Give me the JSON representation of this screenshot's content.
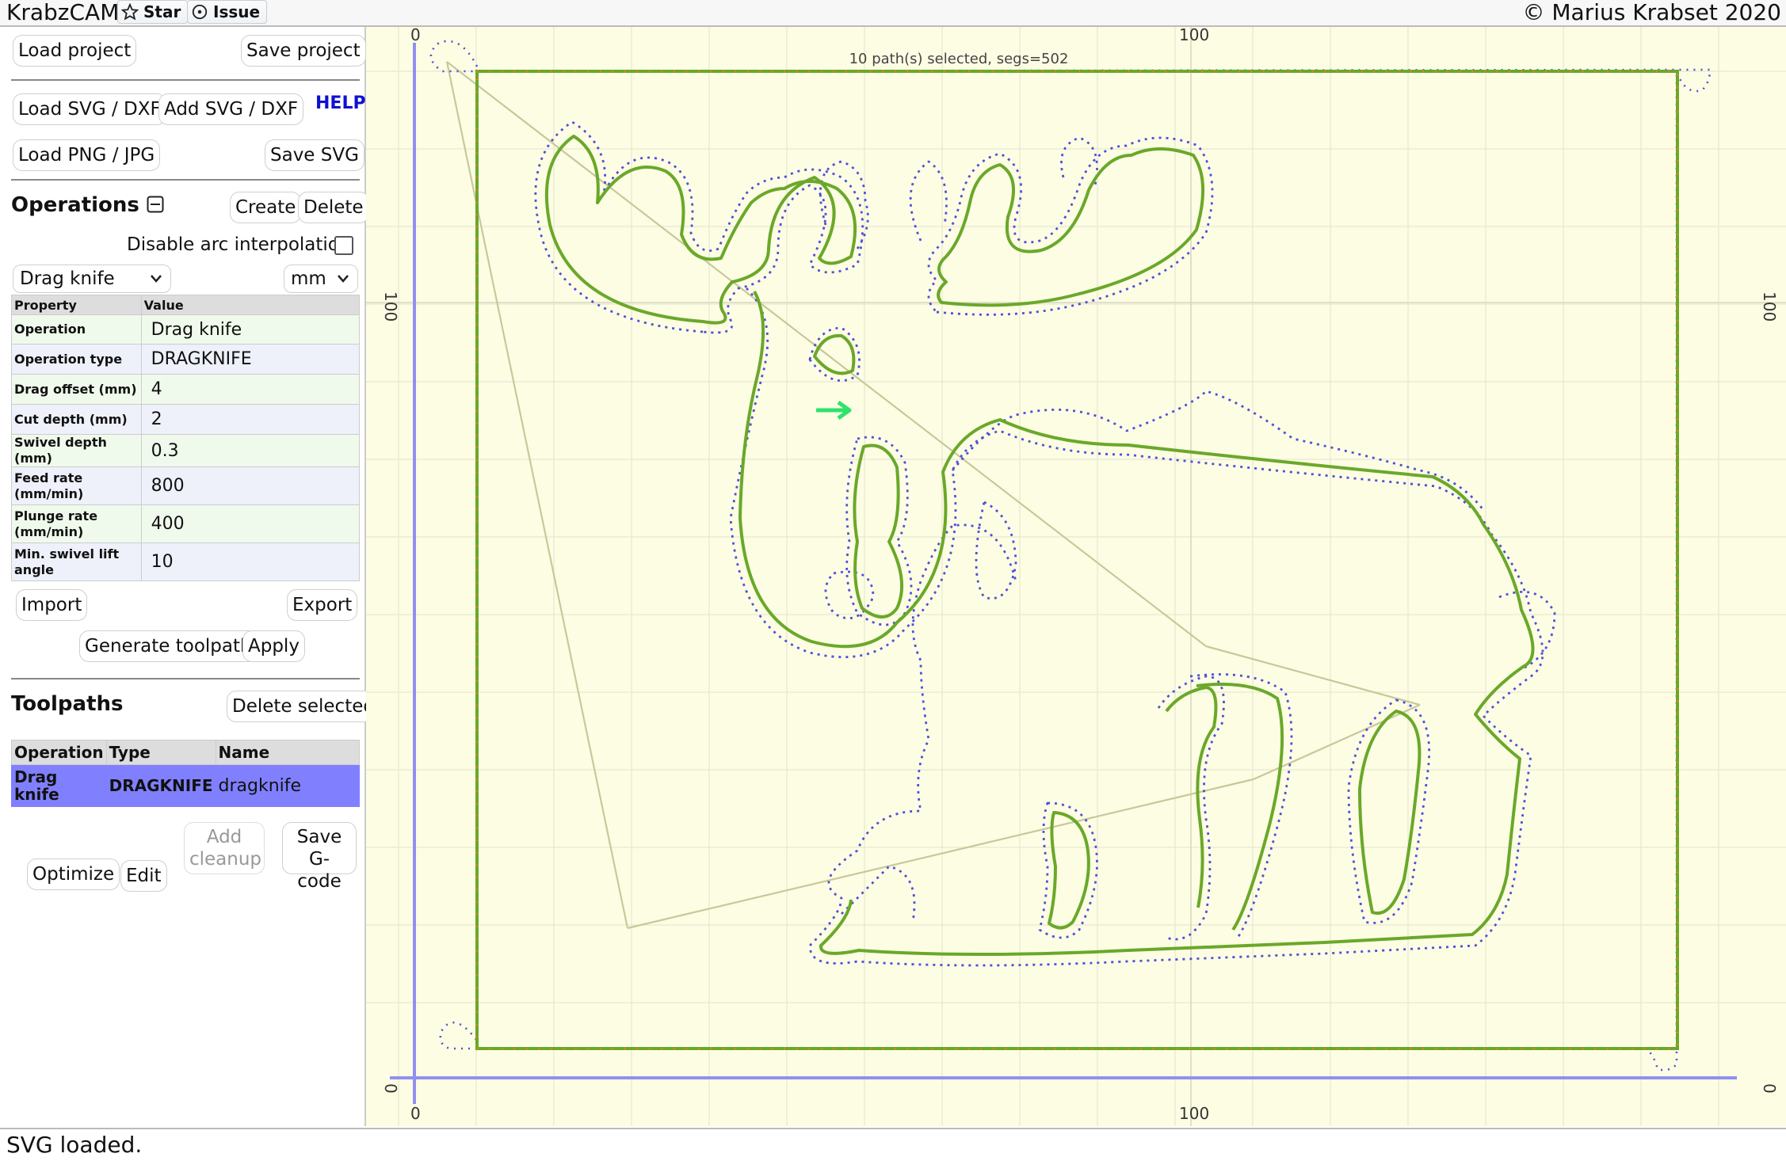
{
  "header": {
    "app_title": "KrabzCAM",
    "star_label": "Star",
    "issue_label": "Issue",
    "copyright": "© Marius Krabset 2020"
  },
  "left_panel": {
    "load_project": "Load project",
    "save_project": "Save project",
    "load_svg_dxf": "Load SVG / DXF",
    "add_svg_dxf": "Add SVG / DXF",
    "help": "HELP",
    "load_png_jpg": "Load PNG / JPG",
    "save_svg": "Save SVG",
    "operations": {
      "title": "Operations",
      "create": "Create",
      "delete": "Delete",
      "disable_arc_label": "Disable arc interpolation",
      "disable_arc_checked": false,
      "operation_select": "Drag knife",
      "unit_select": "mm",
      "table_headers": [
        "Property",
        "Value"
      ],
      "properties": [
        {
          "key": "Operation",
          "value": "Drag knife"
        },
        {
          "key": "Operation type",
          "value": "DRAGKNIFE"
        },
        {
          "key": "Drag offset (mm)",
          "value": "4"
        },
        {
          "key": "Cut depth (mm)",
          "value": "2"
        },
        {
          "key": "Swivel depth (mm)",
          "value": "0.3"
        },
        {
          "key": "Feed rate (mm/min)",
          "value": "800"
        },
        {
          "key": "Plunge rate (mm/min)",
          "value": "400"
        },
        {
          "key": "Min. swivel lift angle",
          "value": "10"
        }
      ],
      "import": "Import",
      "export": "Export",
      "generate_toolpath": "Generate toolpath",
      "apply": "Apply"
    },
    "toolpaths": {
      "title": "Toolpaths",
      "delete_selected": "Delete selected",
      "headers": [
        "Operation",
        "Type",
        "Name"
      ],
      "rows": [
        {
          "operation": "Drag knife",
          "type": "DRAGKNIFE",
          "name": "dragknife"
        }
      ],
      "optimize": "Optimize",
      "edit": "Edit",
      "add_cleanup": "Add cleanup",
      "save_gcode": "Save G-code"
    }
  },
  "canvas": {
    "selection_info": "10 path(s) selected, segs=502",
    "axis_labels": {
      "top_0": "0",
      "top_100": "100",
      "bottom_0": "0",
      "bottom_100": "100",
      "left_0": "0",
      "left_100": "100",
      "right_0": "0",
      "right_100": "100"
    },
    "colors": {
      "background": "#fdfde4",
      "grid": "#e4e4cc",
      "axis": "#9090f0",
      "cut_path": "#6aa82a",
      "toolpath": "#5050d8",
      "points": "#ff7a1a",
      "travel": "#c0c090"
    }
  },
  "status": {
    "text": "SVG loaded."
  }
}
